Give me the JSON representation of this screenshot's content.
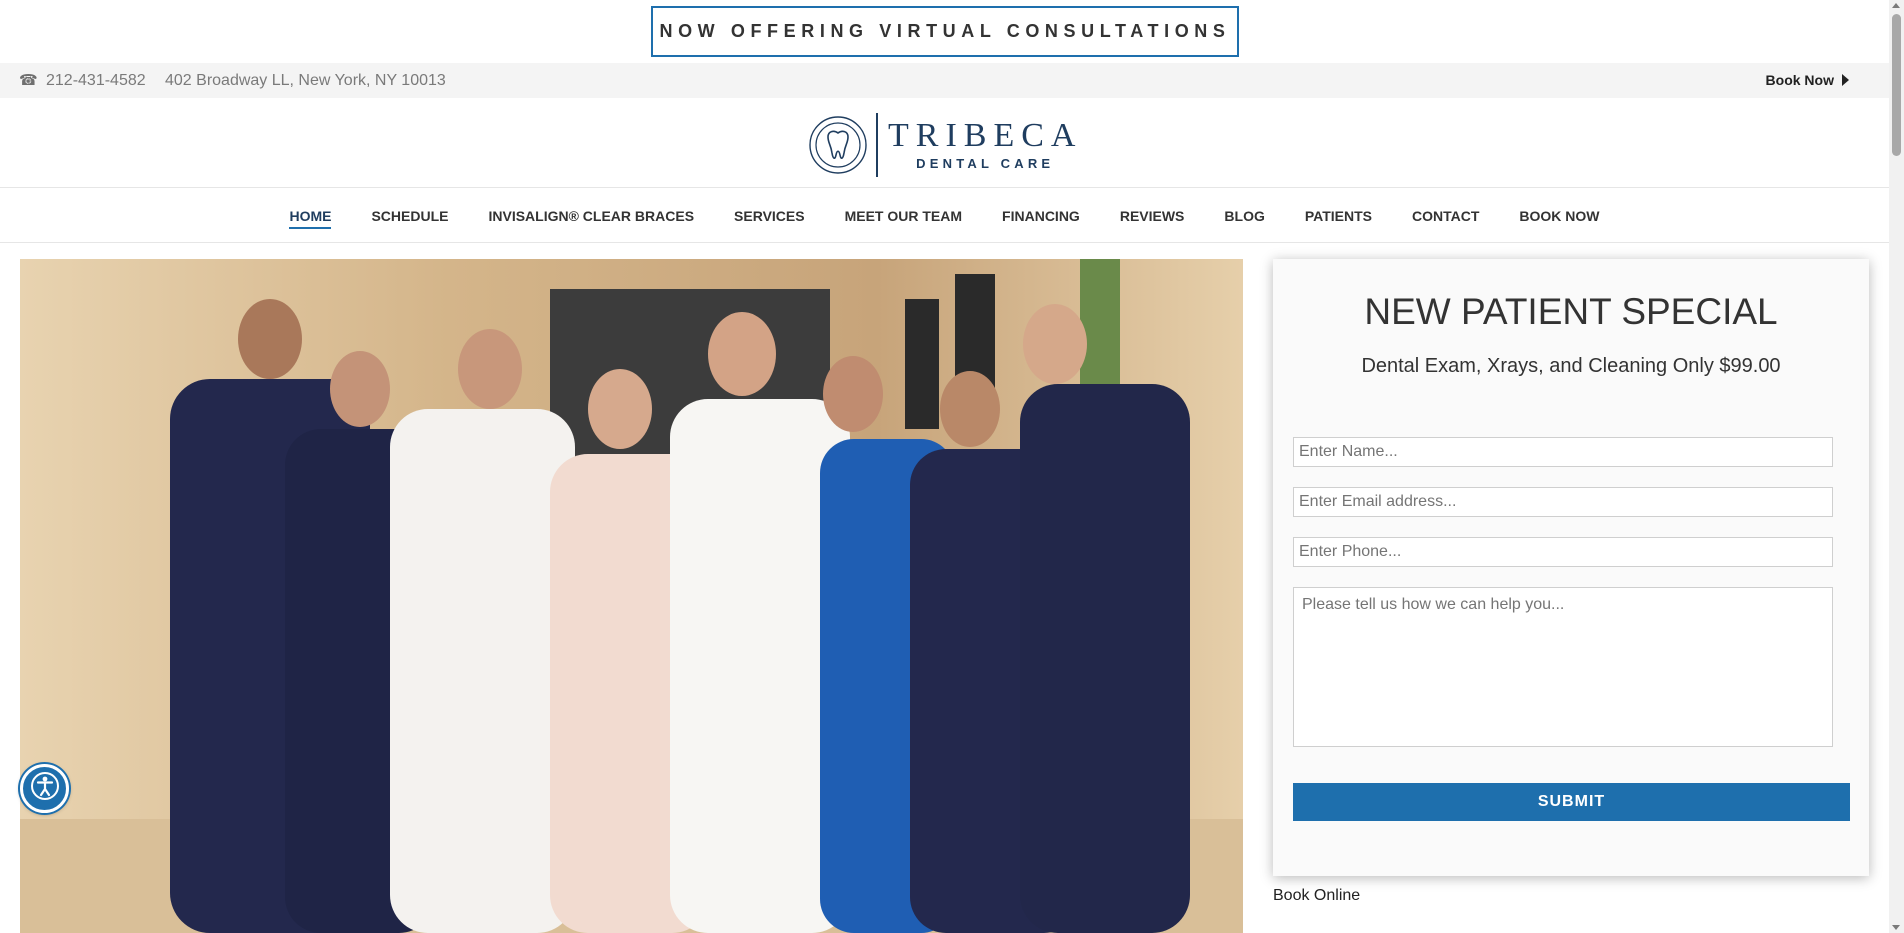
{
  "announcement": {
    "text": "NOW OFFERING VIRTUAL CONSULTATIONS"
  },
  "infobar": {
    "phone_icon": "phone-icon",
    "phone": "212-431-4582",
    "address": "402 Broadway LL, New York, NY 10013",
    "book_now": "Book Now"
  },
  "logo": {
    "main": "TRIBECA",
    "sub": "DENTAL CARE",
    "icon": "tooth-logo-icon"
  },
  "nav": {
    "items": [
      {
        "label": "HOME",
        "active": true
      },
      {
        "label": "SCHEDULE"
      },
      {
        "label": "INVISALIGN® CLEAR BRACES"
      },
      {
        "label": "SERVICES"
      },
      {
        "label": "MEET OUR TEAM"
      },
      {
        "label": "FINANCING"
      },
      {
        "label": "REVIEWS"
      },
      {
        "label": "BLOG"
      },
      {
        "label": "PATIENTS"
      },
      {
        "label": "CONTACT"
      },
      {
        "label": "BOOK NOW"
      }
    ]
  },
  "form": {
    "title": "NEW PATIENT SPECIAL",
    "subtitle": "Dental Exam, Xrays, and Cleaning Only $99.00",
    "name_placeholder": "Enter Name...",
    "email_placeholder": "Enter Email address...",
    "phone_placeholder": "Enter Phone...",
    "message_placeholder": "Please tell us how we can help you...",
    "submit_label": "SUBMIT"
  },
  "book_online": "Book Online",
  "colors": {
    "accent": "#1e6fad",
    "brand_navy": "#1f3d5f",
    "infobar_bg": "#f4f4f4"
  }
}
